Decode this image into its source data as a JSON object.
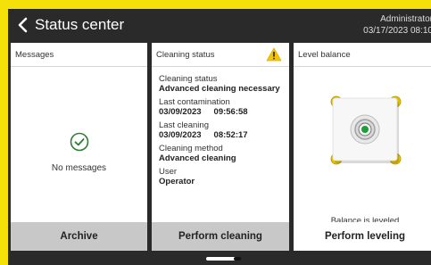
{
  "header": {
    "title": "Status center",
    "user": "Administrator",
    "datetime": "03/17/2023  08:10"
  },
  "messages": {
    "header": "Messages",
    "status": "No messages",
    "footer_button": "Archive"
  },
  "cleaning": {
    "header": "Cleaning status",
    "items": [
      {
        "label": "Cleaning status",
        "value": "Advanced cleaning necessary",
        "time": ""
      },
      {
        "label": "Last contamination",
        "value": "03/09/2023",
        "time": "09:56:58"
      },
      {
        "label": "Last cleaning",
        "value": "03/09/2023",
        "time": "08:52:17"
      },
      {
        "label": "Cleaning method",
        "value": "Advanced cleaning",
        "time": ""
      },
      {
        "label": "User",
        "value": "Operator",
        "time": ""
      }
    ],
    "footer_button": "Perform cleaning"
  },
  "level": {
    "header": "Level balance",
    "status": "Balance is leveled",
    "footer_button": "Perform leveling"
  },
  "colors": {
    "frame": "#f5e10a",
    "screen": "#2a2a2a",
    "ok_green": "#2e7d32",
    "warning": "#f5c400",
    "level_dot": "#1e9e3a"
  }
}
